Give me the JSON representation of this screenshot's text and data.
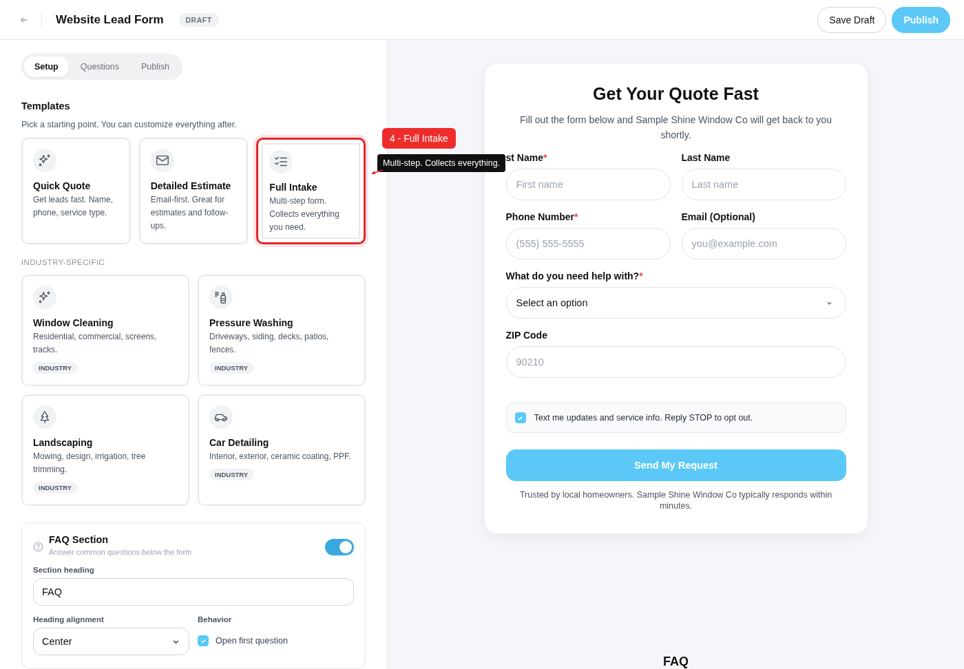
{
  "header": {
    "title": "Website Lead Form",
    "status": "DRAFT",
    "buttons": [
      {
        "label": "Save Draft",
        "kind": "secondary"
      },
      {
        "label": "Publish",
        "kind": "primary"
      }
    ]
  },
  "tabs": [
    {
      "label": "Setup",
      "selected": true
    },
    {
      "label": "Questions",
      "selected": false
    },
    {
      "label": "Publish",
      "selected": false
    }
  ],
  "templates": {
    "heading": "Templates",
    "subtitle": "Pick a starting point. You can customize everything after.",
    "items": [
      {
        "title": "Quick Quote",
        "description": "Get leads fast. Name, phone, service type.",
        "kind": "sparkle",
        "selected": false
      },
      {
        "title": "Detailed Estimate",
        "description": "Email-first. Great for estimates and follow-ups.",
        "kind": "mail",
        "selected": false
      },
      {
        "title": "Full Intake",
        "description": "Multi-step form. Collects everything you need.",
        "kind": "checklist",
        "selected": true
      }
    ]
  },
  "industry": {
    "heading": "INDUSTRY-SPECIFIC",
    "items": [
      {
        "title": "Window Cleaning",
        "description": "Residential, commercial, screens, tracks.",
        "tag": "INDUSTRY",
        "kind": "sparkle"
      },
      {
        "title": "Pressure Washing",
        "description": "Driveways, siding, decks, patios, fences.",
        "tag": "INDUSTRY",
        "kind": "spray"
      },
      {
        "title": "Landscaping",
        "description": "Mowing, design, irrigation, tree trimming.",
        "tag": "INDUSTRY",
        "kind": "tree"
      },
      {
        "title": "Car Detailing",
        "description": "Interior, exterior, ceramic coating, PPF.",
        "tag": "INDUSTRY",
        "kind": "car"
      }
    ]
  },
  "faq_settings": {
    "title": "FAQ Section",
    "subtitle": "Answer common questions below the form",
    "on": true,
    "heading_label": "Section heading",
    "heading_value": "FAQ",
    "alignment_label": "Heading alignment",
    "alignment_value": "Center",
    "behavior_label": "Behavior",
    "open_first": {
      "label": "Open first question",
      "checked": true
    }
  },
  "annotation": {
    "badge": "4 - Full Intake",
    "tooltip": "Multi-step. Collects everything."
  },
  "preview": {
    "title": "Get Your Quote Fast",
    "intro": "Fill out the form below and Sample Shine Window Co will get back to you shortly.",
    "fields": [
      {
        "label": "st Name",
        "required_mark": "*",
        "placeholder": "First name",
        "kind": "half"
      },
      {
        "label": "Last Name",
        "placeholder": "Last name",
        "kind": "half"
      },
      {
        "label": "Phone Number",
        "required_mark": "*",
        "placeholder": "(555) 555-5555",
        "kind": "half"
      },
      {
        "label": "Email (Optional)",
        "placeholder": "you@example.com",
        "kind": "half"
      },
      {
        "label": "What do you need help with?",
        "required_mark": "*",
        "value": "Select an option",
        "kind": "select"
      },
      {
        "label": "ZIP Code",
        "placeholder": "90210",
        "kind": "full"
      }
    ],
    "consent": {
      "label": "Text me updates and service info. Reply STOP to opt out.",
      "checked": true
    },
    "submit": "Send My Request",
    "footnote": "Trusted by local homeowners. Sample Shine Window Co typically responds within minutes.",
    "faq_heading": "FAQ"
  }
}
